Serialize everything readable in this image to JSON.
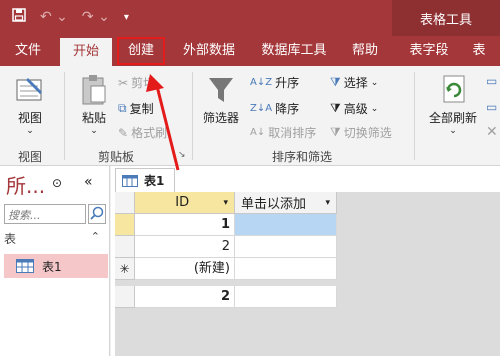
{
  "titlebar": {
    "context_title": "表格工具"
  },
  "tabs": [
    "文件",
    "开始",
    "创建",
    "外部数据",
    "数据库工具",
    "帮助",
    "表字段",
    "表"
  ],
  "ribbon": {
    "view": {
      "label": "视图",
      "group": "视图"
    },
    "clipboard": {
      "paste": "粘贴",
      "cut": "剪切",
      "copy": "复制",
      "format_painter": "格式刷",
      "group": "剪贴板"
    },
    "sort_filter": {
      "filter": "筛选器",
      "asc": "升序",
      "desc": "降序",
      "remove_sort": "取消排序",
      "select": "选择",
      "advanced": "高级",
      "toggle_filter": "切换筛选",
      "group": "排序和筛选"
    },
    "records": {
      "refresh_all": "全部刷新"
    }
  },
  "nav": {
    "title": "所...",
    "search_placeholder": "搜索...",
    "section": "表",
    "table": "表1"
  },
  "document": {
    "tab": "表1",
    "columns": [
      "ID",
      "单击以添加"
    ],
    "rows": [
      {
        "selector": "",
        "id": "1"
      },
      {
        "selector": "",
        "id": "2"
      },
      {
        "selector": "✳",
        "id": "(新建)"
      }
    ],
    "total": "2"
  }
}
